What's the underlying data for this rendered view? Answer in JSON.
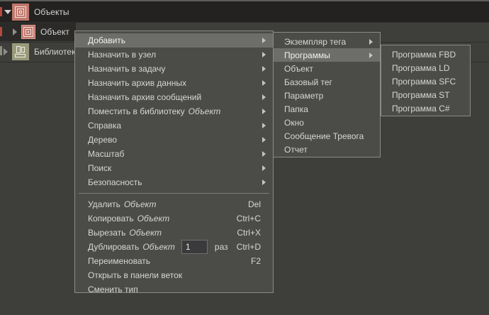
{
  "colors": {
    "background": "#3e3e3b",
    "menu_background": "#4b4b48",
    "menu_border": "#8a8a86",
    "menu_highlight": "#6d6d69",
    "tree_selected_row": "#232220",
    "object_icon": "#c0786c",
    "library_icon": "#9a9a7c",
    "marker_red": "#b4493f",
    "marker_gray": "#8d8d80"
  },
  "tree": {
    "items": [
      {
        "name": "objects",
        "label": "Объекты",
        "expander": "down",
        "icon": "objects-icon",
        "marker": "#b4493f",
        "selected": true
      },
      {
        "name": "object",
        "label": "Объект",
        "expander": "right",
        "icon": "object-icon",
        "marker": "#b4493f",
        "selected": false
      },
      {
        "name": "libraries",
        "label": "Библиотеки",
        "expander": "right",
        "icon": "libraries-icon",
        "marker": "#8d8d80",
        "selected": false
      }
    ]
  },
  "context_menu": {
    "items": [
      {
        "name": "add",
        "label": "Добавить",
        "submenu": true,
        "highlighted": true
      },
      {
        "name": "assign-to-node",
        "label": "Назначить в узел",
        "submenu": true
      },
      {
        "name": "assign-to-task",
        "label": "Назначить в задачу",
        "submenu": true
      },
      {
        "name": "assign-data-archive",
        "label": "Назначить архив данных",
        "submenu": true
      },
      {
        "name": "assign-message-archive",
        "label": "Назначить архив сообщений",
        "submenu": true
      },
      {
        "name": "put-in-library",
        "label": "Поместить в библиотеку",
        "italic": "Объект",
        "submenu": true
      },
      {
        "name": "help",
        "label": "Справка",
        "submenu": true
      },
      {
        "name": "tree",
        "label": "Дерево",
        "submenu": true
      },
      {
        "name": "zoom",
        "label": "Масштаб",
        "submenu": true
      },
      {
        "name": "search",
        "label": "Поиск",
        "submenu": true
      },
      {
        "name": "security",
        "label": "Безопасность",
        "submenu": true
      },
      {
        "separator": true
      },
      {
        "name": "delete",
        "label": "Удалить",
        "italic": "Объект",
        "shortcut": "Del"
      },
      {
        "name": "copy",
        "label": "Копировать",
        "italic": "Объект",
        "shortcut": "Ctrl+C"
      },
      {
        "name": "cut",
        "label": "Вырезать",
        "italic": "Объект",
        "shortcut": "Ctrl+X"
      },
      {
        "name": "duplicate",
        "label": "Дублировать",
        "italic": "Объект",
        "input_value": "1",
        "suffix": "раз",
        "shortcut": "Ctrl+D"
      },
      {
        "name": "rename",
        "label": "Переименовать",
        "shortcut": "F2"
      },
      {
        "name": "open-in-branches-panel",
        "label": "Открыть в панели веток"
      },
      {
        "name": "change-type",
        "label": "Сменить тип"
      }
    ]
  },
  "add_submenu": {
    "items": [
      {
        "name": "tag-instance",
        "label": "Экземпляр тега",
        "submenu": true
      },
      {
        "name": "programs",
        "label": "Программы",
        "submenu": true,
        "highlighted": true
      },
      {
        "name": "object",
        "label": "Объект"
      },
      {
        "name": "base-tag",
        "label": "Базовый тег"
      },
      {
        "name": "parameter",
        "label": "Параметр"
      },
      {
        "name": "folder",
        "label": "Папка"
      },
      {
        "name": "window",
        "label": "Окно"
      },
      {
        "name": "message-alarm",
        "label": "Сообщение Тревога"
      },
      {
        "name": "report",
        "label": "Отчет"
      }
    ]
  },
  "programs_submenu": {
    "items": [
      {
        "name": "program-fbd",
        "label": "Программа FBD"
      },
      {
        "name": "program-ld",
        "label": "Программа LD"
      },
      {
        "name": "program-sfc",
        "label": "Программа SFC"
      },
      {
        "name": "program-st",
        "label": "Программа ST"
      },
      {
        "name": "program-csharp",
        "label": "Программа C#"
      }
    ]
  }
}
